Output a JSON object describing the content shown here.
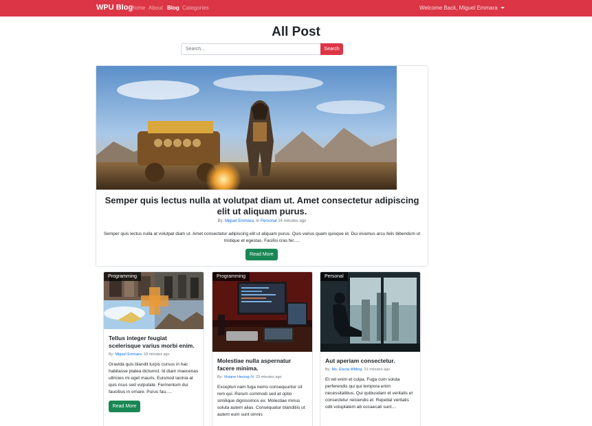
{
  "navbar": {
    "brand": "WPU Blog",
    "links": [
      "Home",
      "About",
      "Blog",
      "Categories"
    ],
    "user": "Welcome Back, Miguel Emmara"
  },
  "page": {
    "title": "All Post",
    "search_placeholder": "Search...",
    "search_button": "Search"
  },
  "hero": {
    "title": "Semper quis lectus nulla at volutpat diam ut. Amet consectetur adipiscing elit ut aliquam purus.",
    "meta_by": "By:",
    "author": "Miguel Emmara",
    "meta_in": ". In",
    "category": "Personal",
    "time": "14 minutes ago",
    "excerpt": "Semper quis lectus nulla at volutpat diam ut. Amet consectetur adipiscing elit ut aliquam purus. Quis varius quam quisque id. Dui vivamus arcu felis bibendum ut tristique et egestas. Facilisi cras fer.....",
    "button": "Read More"
  },
  "cards": [
    {
      "category": "Programming",
      "title": "Tellus integer feugiat scelerisque varius morbi enim.",
      "meta_by": "By:",
      "author": "Miguel Emmara",
      "time": ". 18 minutes ago",
      "excerpt": "Gravida quis blandit turpis cursus in hac habitasse platea dictumst. Id diam maecenas ultricies mi eget mauris. Euismod lacinia at quis risus sed vulputate. Fermentum dui faucibus in ornare. Purus fau.....",
      "button": "Read More"
    },
    {
      "category": "Programming",
      "title": "Molestiae nulla aspernatur facere minima.",
      "meta_by": "By:",
      "author": "Viviane Herzog IV",
      "time": ". 23 minutes ago",
      "excerpt": "Excepturi nam fuga nemo consequuntur sit rem qui. Rerum commodi sed at optio similique dignissimos ex. Molestiae minus soluta autem alias. Consequatur blanditiis ut autem eum sunt omnis"
    },
    {
      "category": "Personal",
      "title": "Aut aperiam consectetur.",
      "meta_by": "By:",
      "author": "Ms. Electa Witting",
      "time": ". 23 minutes ago",
      "excerpt": "Et vel enim et culpa. Fuga cum soluta perferendis qui qui tempora enim necessitatibus. Qui quibusdam et veritatis et consectetur reiciendis et. Repellat veritatis odit voluptatem ab occaecati sunt...."
    }
  ],
  "colors": {
    "primary": "#dc3545",
    "success": "#198754",
    "link": "#0d6efd"
  }
}
